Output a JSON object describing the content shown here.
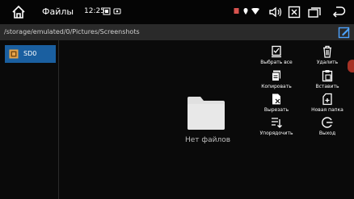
{
  "status_bar": {
    "app_title": "Файлы",
    "time": "12:25"
  },
  "path_bar": {
    "path": "/storage/emulated/0/Pictures/Screenshots"
  },
  "sidebar": {
    "items": [
      {
        "label": "SD0"
      }
    ]
  },
  "main": {
    "empty_message": "Нет файлов"
  },
  "context_menu": {
    "items": [
      {
        "label": "Выбрать все",
        "icon": "select-all-icon"
      },
      {
        "label": "Удалить",
        "icon": "trash-icon"
      },
      {
        "label": "Копировать",
        "icon": "copy-icon"
      },
      {
        "label": "Вставить",
        "icon": "paste-icon"
      },
      {
        "label": "Вырезать",
        "icon": "cut-icon"
      },
      {
        "label": "Новая папка",
        "icon": "new-folder-icon"
      },
      {
        "label": "Упорядочить",
        "icon": "sort-icon"
      },
      {
        "label": "Выход",
        "icon": "exit-icon"
      }
    ]
  },
  "colors": {
    "accent": "#1a5fa0",
    "background": "#0a0a0a",
    "path_bar": "#2a2a2a"
  }
}
